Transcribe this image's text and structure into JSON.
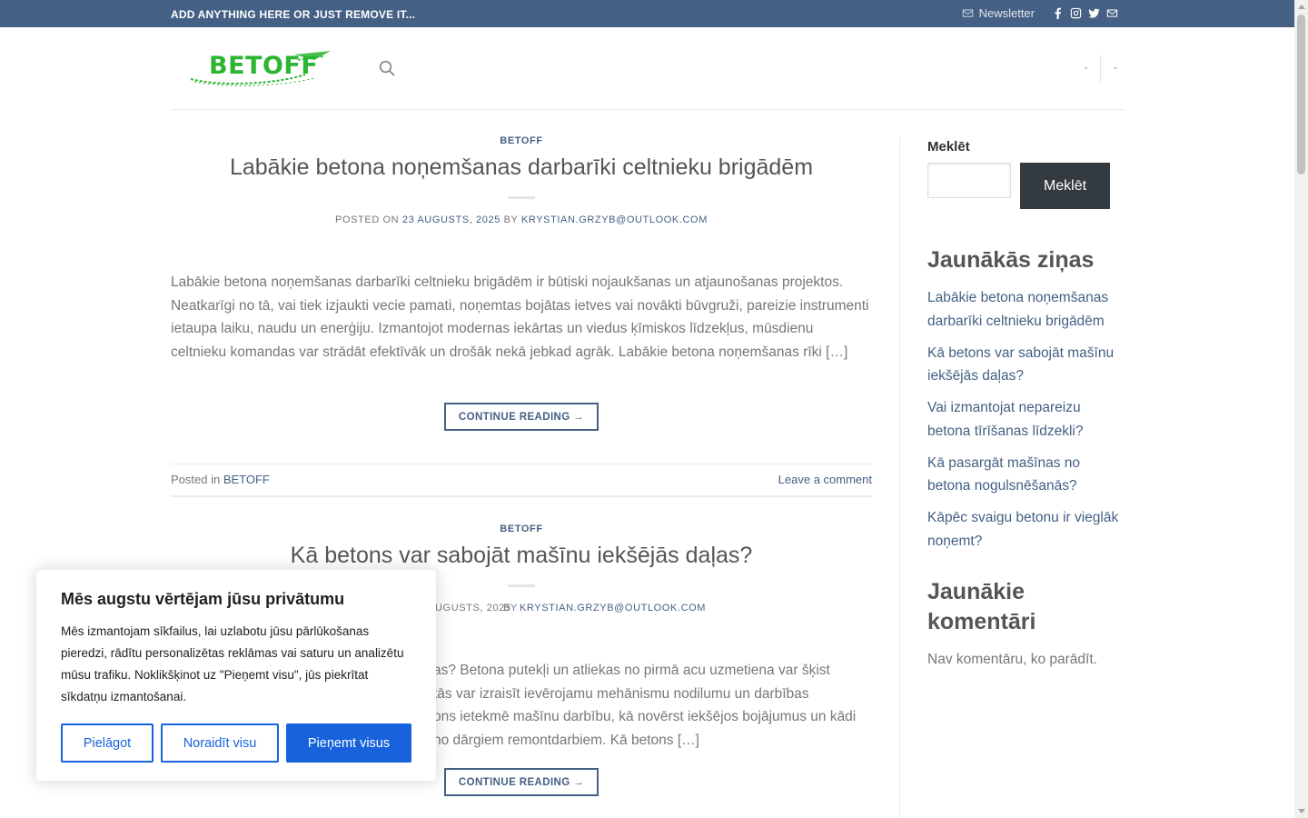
{
  "topbar": {
    "text": "ADD ANYTHING HERE OR JUST REMOVE IT...",
    "newsletter": "Newsletter",
    "social": [
      "facebook-icon",
      "instagram-icon",
      "twitter-icon",
      "mail-icon"
    ]
  },
  "header": {
    "logo": "BETOFF",
    "right_items": [
      "-",
      "-"
    ]
  },
  "posts": [
    {
      "category": "BETOFF",
      "title": "Labākie betona noņemšanas darbarīki celtnieku brigādēm",
      "posted_on": "POSTED ON",
      "date": "23 AUGUSTS, 2025",
      "by": "BY",
      "author": "KRYSTIAN.GRZYB@OUTLOOK.COM",
      "excerpt": "Labākie betona noņemšanas darbarīki celtnieku brigādēm ir būtiski nojaukšanas un atjaunošanas projektos. Neatkarīgi no tā, vai tiek izjaukti vecie pamati, noņemtas bojātas ietves vai novākti būvgruži, pareizie instrumenti ietaupa laiku, naudu un enerģiju. Izmantojot modernas iekārtas un viedus ķīmiskos līdzekļus, mūsdienu celtnieku komandas var strādāt efektīvāk un drošāk nekā jebkad agrāk. Labākie betona noņemšanas rīki […]",
      "continue": "CONTINUE READING →",
      "posted_in": "Posted in",
      "posted_in_cat": "BETOFF",
      "comment": "Leave a comment"
    },
    {
      "category": "BETOFF",
      "title": "Kā betons var sabojāt mašīnu iekšējās daļas?",
      "meta_visible": "UGUSTS, 2025",
      "by": "BY",
      "author": "KRYSTIAN.GRZYB@OUTLOOK.COM",
      "excerpt_lines": [
        "as? Betona putekļi un atliekas no pirmā acu uzmetiena var šķist",
        "tās var izraisīt ievērojamu mehānismu nodilumu un darbības",
        "ons ietekmē mašīnu darbību, kā novērst iekšējos bojājumus un kādi",
        "no dārgiem remontdarbiem. Kā betons […]"
      ],
      "continue": "CONTINUE READING →"
    }
  ],
  "sidebar": {
    "search_label": "Meklēt",
    "search_button": "Meklēt",
    "recent_title": "Jaunākās ziņas",
    "recent_posts": [
      "Labākie betona noņemšanas darbarīki celtnieku brigādēm",
      "Kā betons var sabojāt mašīnu iekšējās daļas?",
      "Vai izmantojat nepareizu betona tīrīšanas līdzekli?",
      "Kā pasargāt mašīnas no betona nogulsnēšanās?",
      "Kāpēc svaigu betonu ir vieglāk noņemt?"
    ],
    "comments_title": "Jaunākie komentāri",
    "no_comments": "Nav komentāru, ko parādīt."
  },
  "cookie": {
    "title": "Mēs augstu vērtējam jūsu privātumu",
    "text": "Mēs izmantojam sīkfailus, lai uzlabotu jūsu pārlūkošanas pieredzi, rādītu personalizētas reklāmas vai saturu un analizētu mūsu trafiku. Noklikšķinot uz \"Pieņemt visu\", jūs piekrītat sīkdatņu izmantošanai.",
    "customize": "Pielāgot",
    "reject": "Noraidīt visu",
    "accept": "Pieņemt visus"
  },
  "colors": {
    "topbar": "#446084",
    "link": "#446084",
    "logo_green": "#2bb530",
    "cookie_accent": "#1863dc",
    "search_button": "#333a40"
  }
}
